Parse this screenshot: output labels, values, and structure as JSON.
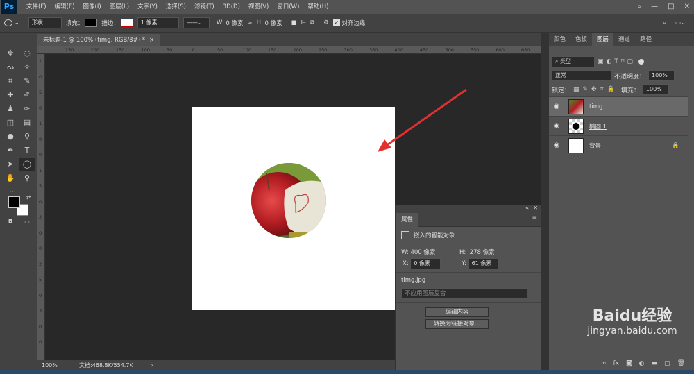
{
  "menubar": {
    "logo": "Ps",
    "items": [
      "文件(F)",
      "编辑(E)",
      "图像(I)",
      "图层(L)",
      "文字(Y)",
      "选择(S)",
      "滤镜(T)",
      "3D(D)",
      "视图(V)",
      "窗口(W)",
      "帮助(H)"
    ],
    "win_buttons": [
      "—",
      "□",
      "✕"
    ]
  },
  "options": {
    "mode": "形状",
    "fill_label": "填充：",
    "stroke_label": "描边：",
    "stroke_width": "1 像素",
    "w_label": "W:",
    "w_value": "0 像素",
    "h_label": "H:",
    "h_value": "0 像素",
    "align_label": "对齐边缘"
  },
  "doc_tab": {
    "title": "未标题-1 @ 100% (timg, RGB/8#) *",
    "close": "×"
  },
  "ruler_h": [
    "250",
    "200",
    "150",
    "100",
    "50",
    "0",
    "50",
    "100",
    "150",
    "200",
    "250",
    "300",
    "350",
    "400",
    "450",
    "500",
    "550",
    "600",
    "650"
  ],
  "ruler_v": [
    "1",
    "0",
    "5",
    "0",
    "1",
    "0",
    "0",
    "1",
    "5",
    "0",
    "2",
    "0",
    "0",
    "2",
    "5",
    "0",
    "3",
    "0",
    "0"
  ],
  "statusbar": {
    "zoom": "100%",
    "doc_info": "文档:468.8K/554.7K",
    "arrow": "›"
  },
  "properties": {
    "tab": "属性",
    "type": "嵌入的智能对象",
    "w_label": "W:",
    "w_value": "400 像素",
    "h_label": "H:",
    "h_value": "278 像素",
    "x_label": "X:",
    "x_value": "0 像素",
    "y_label": "Y:",
    "y_value": "61 像素",
    "filename": "timg.jpg",
    "comp_placeholder": "不应用图层复合",
    "edit_btn": "编辑内容",
    "convert_btn": "转换为链接对象..."
  },
  "panel_tabs": [
    "颜色",
    "色板",
    "图层",
    "通道",
    "路径"
  ],
  "layers_panel": {
    "filter": "类型",
    "blend": "正常",
    "opacity_label": "不透明度：",
    "opacity": "100%",
    "lock_label": "锁定：",
    "fill_label": "填充：",
    "fill": "100%",
    "items": [
      {
        "name": "timg"
      },
      {
        "name": "椭圆 1"
      },
      {
        "name": "背景"
      }
    ],
    "bottom_icons": [
      "fx"
    ]
  },
  "watermark": {
    "brand": "Baidu经验",
    "url": "jingyan.baidu.com"
  },
  "colors": {
    "accent": "#31a8ff",
    "arrow": "#e03030"
  }
}
